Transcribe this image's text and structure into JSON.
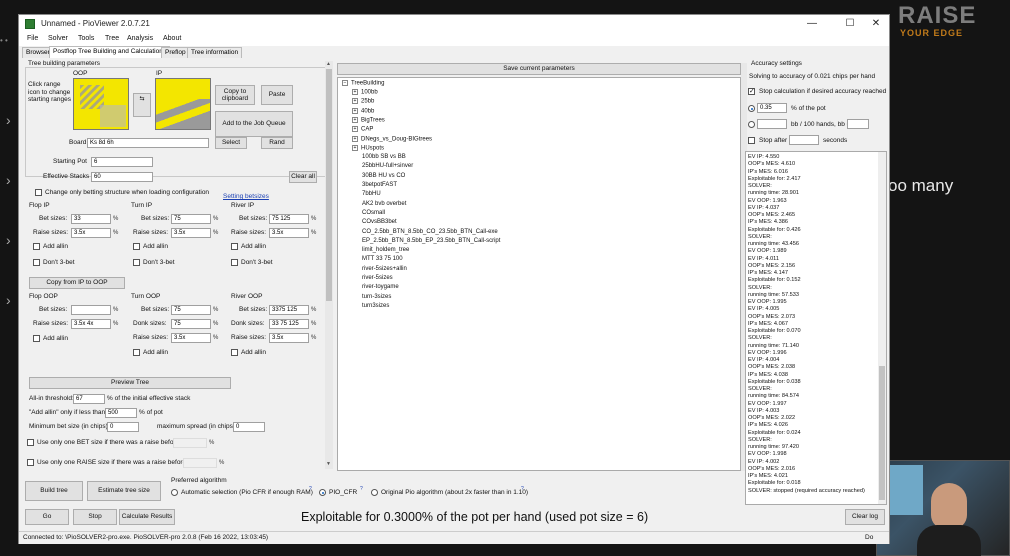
{
  "window": {
    "title": "Unnamed - PioViewer 2.0.7.21",
    "controls": [
      "—",
      "☐",
      "✕"
    ]
  },
  "menu": [
    "File",
    "Solver",
    "Tools",
    "Tree",
    "Analysis",
    "About"
  ],
  "tabs": [
    "Browser",
    "Postflop Tree Building and Calculations",
    "Preflop",
    "Tree information"
  ],
  "left": {
    "section_title": "Tree building parameters",
    "click_range_hint": "Click range icon to change starting ranges",
    "oop_label": "OOP",
    "ip_label": "IP",
    "swap_label": "<-\n->",
    "copy_clipboard": "Copy to clipboard",
    "paste": "Paste",
    "add_job_queue": "Add to the Job Queue",
    "board_label": "Board",
    "board_value": "Ks 8d 6h",
    "select": "Select",
    "rand": "Rand",
    "starting_pot_label": "Starting Pot",
    "starting_pot_value": "6",
    "effective_stacks_label": "Effective Stacks",
    "effective_stacks_value": "60",
    "change_only_betting": "Change only betting structure when loading configuration",
    "setting_betsizes": "Setting betsizes",
    "clear_all": "Clear all",
    "flop_ip": "Flop IP",
    "turn_ip": "Turn IP",
    "river_ip": "River IP",
    "flop_oop": "Flop OOP",
    "turn_oop": "Turn OOP",
    "river_oop": "River OOP",
    "bet_sizes": "Bet sizes:",
    "raise_sizes": "Raise sizes:",
    "donk_sizes": "Donk sizes:",
    "add_allin": "Add allin",
    "dont_3bet": "Don't 3-bet",
    "pct": "%",
    "flop_ip_bet": "33",
    "flop_ip_raise": "3.5x",
    "turn_ip_bet": "75",
    "turn_ip_raise": "3.5x",
    "river_ip_bet": "75 125",
    "river_ip_raise": "3.5x",
    "copy_ip_to_oop": "Copy from IP to OOP",
    "flop_oop_bet": "",
    "flop_oop_raise": "3.5x 4x",
    "turn_oop_bet": "75",
    "turn_oop_donk": "75",
    "turn_oop_raise": "3.5x",
    "river_oop_bet": "3375 125",
    "river_oop_donk": "33 75 125",
    "river_oop_raise": "3.5x",
    "preview_tree": "Preview Tree",
    "allin_threshold_label": "All-in threshold:",
    "allin_threshold_value": "67",
    "allin_threshold_suffix": "% of the initial effective stack",
    "add_allin_only_label": "\"Add allin\" only if less than",
    "add_allin_only_value": "500",
    "add_allin_only_suffix": "% of pot",
    "min_bet_label": "Minimum bet size (in chips):",
    "min_bet_value": "0",
    "max_spread_label": "maximum spread (in chips):",
    "max_spread_value": "0",
    "one_bet_label": "Use only one BET size if there was a raise before",
    "one_raise_label": "Use only one RAISE size if there was a raise before",
    "build_tree": "Build tree",
    "estimate_tree_size": "Estimate tree size",
    "preferred_algorithm": "Preferred algorithm",
    "algo_auto": "Automatic selection (Pio CFR if enough RAM)",
    "algo_pio_cfr": "PIO_CFR",
    "algo_original": "Original Pio algorithm (about 2x faster than in 1.10)",
    "help_mark": "?",
    "go": "Go",
    "stop": "Stop",
    "calculate_results": "Calculate Results"
  },
  "middle": {
    "save_current": "Save current parameters",
    "tree_root": "TreeBuilding",
    "folders": [
      "100bb",
      "25bb",
      "40bb",
      "BigTrees",
      "CAP",
      "DNegs_vs_Doug-BIGtrees",
      "HUspots"
    ],
    "files": [
      "100bb SB vs BB",
      "25bbHU-full+sinver",
      "30BB HU vs CO",
      "3betpotFAST",
      "7bbHU",
      "AK2 bvb overbet",
      "COsmall",
      "COvsBB3bet",
      "CO_2.5bb_BTN_8.5bb_CO_23.5bb_BTN_Call-exe",
      "EP_2.5bb_BTN_8.5bb_EP_23.5bb_BTN_Call-script",
      "limit_holdem_tree",
      "MTT 33 75 100",
      "river-5sizes+allin",
      "river-5sizes",
      "river-toygame",
      "turn-3sizes",
      "turn3sizes"
    ]
  },
  "right": {
    "accuracy_settings": "Accuracy settings",
    "solving_to": "Solving to accuracy of 0.021 chips per hand",
    "stop_calc_label": "Stop calculation if desired accuracy reached",
    "pct_pot_value": "0.35",
    "pct_pot_label": "% of the pot",
    "bb100_label": "bb / 100 hands, bb =",
    "stop_after_label": "Stop after",
    "seconds_label": "seconds",
    "log": [
      "EV IP: 4.550",
      "OOP's MES: 4.610",
      "IP's MES: 6.016",
      "Exploitable for: 2.417",
      "SOLVER:",
      "running time: 28.901",
      "EV OOP: 1.963",
      "EV IP: 4.037",
      "OOP's MES: 2.465",
      "IP's MES: 4.386",
      "Exploitable for: 0.426",
      "SOLVER:",
      "running time: 43.456",
      "EV OOP: 1.989",
      "EV IP: 4.011",
      "OOP's MES: 2.156",
      "IP's MES: 4.147",
      "Exploitable for: 0.152",
      "SOLVER:",
      "running time: 57.533",
      "EV OOP: 1.995",
      "EV IP: 4.005",
      "OOP's MES: 2.073",
      "IP's MES: 4.067",
      "Exploitable for: 0.070",
      "SOLVER:",
      "running time: 71.140",
      "EV OOP: 1.996",
      "EV IP: 4.004",
      "OOP's MES: 2.038",
      "IP's MES: 4.038",
      "Exploitable for: 0.038",
      "SOLVER:",
      "running time: 84.574",
      "EV OOP: 1.997",
      "EV IP: 4.003",
      "OOP's MES: 2.022",
      "IP's MES: 4.026",
      "Exploitable for: 0.024",
      "SOLVER:",
      "running time: 97.420",
      "EV OOP: 1.998",
      "EV IP: 4.002",
      "OOP's MES: 2.016",
      "IP's MES: 4.021",
      "Exploitable for: 0.018",
      "SOLVER: stopped (required accuracy reached)"
    ],
    "clear_log": "Clear log"
  },
  "exploitable_banner": "Exploitable for 0.3000% of the pot per hand (used pot size = 6)",
  "status_bar": "Connected to: \\PioSOLVER2-pro.exe. PioSOLVER-pro 2.0.8 (Feb 16 2022, 13:03:45)",
  "status_right": "Do",
  "background": {
    "logo_line1": "RAISE",
    "logo_line2": "YOUR EDGE",
    "side_text": "oo many"
  },
  "colors": {
    "range_yellow": "#f3e600",
    "range_grey": "#9a9a9a",
    "link_blue": "#1a3fb3"
  }
}
